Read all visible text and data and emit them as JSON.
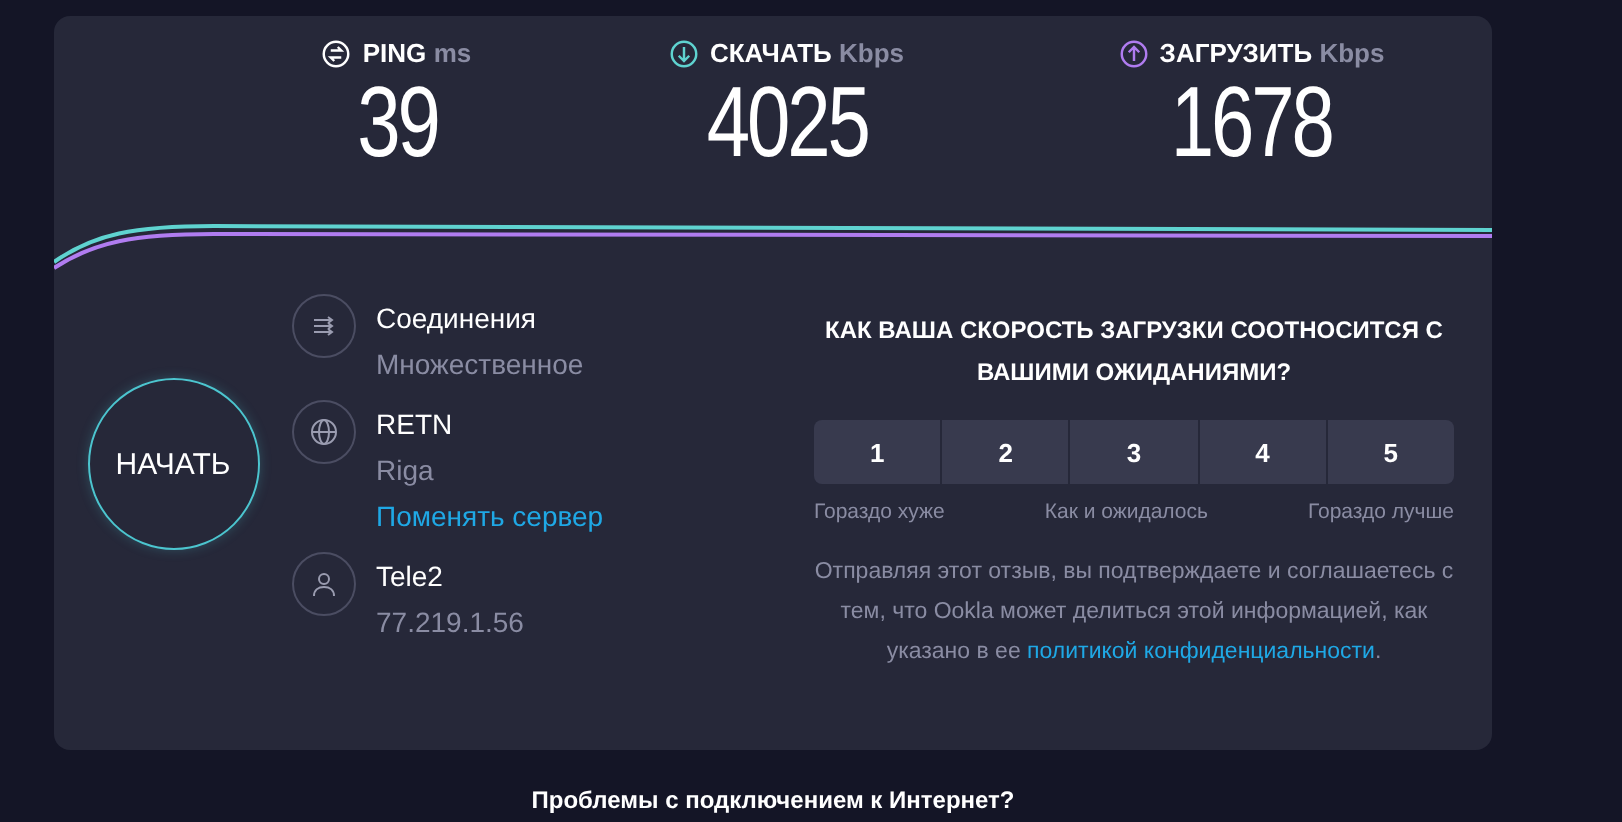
{
  "metrics": [
    {
      "kind": "ping",
      "label": "PING",
      "unit": "ms",
      "value": "39",
      "color": "#ffffff"
    },
    {
      "kind": "download",
      "label": "СКАЧАТЬ",
      "unit": "Kbps",
      "value": "4025",
      "color": "#5fd3d0"
    },
    {
      "kind": "upload",
      "label": "ЗАГРУЗИТЬ",
      "unit": "Kbps",
      "value": "1678",
      "color": "#b07cf0"
    }
  ],
  "start_button": {
    "label": "НАЧАТЬ"
  },
  "info": [
    {
      "kind": "connections",
      "title": "Соединения",
      "subtitle": "Множественное"
    },
    {
      "kind": "server",
      "title": "RETN",
      "subtitle": "Riga",
      "link": "Поменять сервер"
    },
    {
      "kind": "provider",
      "title": "Tele2",
      "subtitle": "77.219.1.56"
    }
  ],
  "survey": {
    "question": "КАК ВАША СКОРОСТЬ ЗАГРУЗКИ СООТНОСИТСЯ С ВАШИМИ ОЖИДАНИЯМИ?",
    "ratings": [
      "1",
      "2",
      "3",
      "4",
      "5"
    ],
    "scale_labels": [
      "Гораздо хуже",
      "Как и ожидалось",
      "Гораздо лучше"
    ],
    "disclaimer_before": "Отправляя этот отзыв, вы подтверждаете и соглашаетесь с тем, что Ookla может делиться этой информацией, как указано в ее",
    "disclaimer_link": "политикой конфиденциальности",
    "disclaimer_after": "."
  },
  "footer_question": "Проблемы с подключением к Интернет?"
}
